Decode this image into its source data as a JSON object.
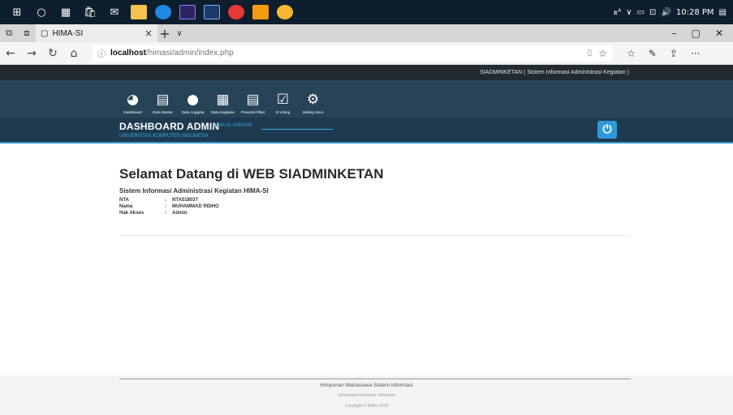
{
  "taskbar": {
    "start_icon": "windows-start-icon",
    "search_icon": "cortana-circle-icon",
    "apps": [
      {
        "name": "task-view-icon",
        "color": "#0f1e2e"
      },
      {
        "name": "store-icon",
        "color": "#0f1e2e"
      },
      {
        "name": "mail-icon",
        "color": "#0f1e2e"
      },
      {
        "name": "file-explorer-icon",
        "color": "#f2c14e"
      },
      {
        "name": "edge-icon",
        "color": "#1e88e5"
      },
      {
        "name": "premiere-icon",
        "color": "#2b2563"
      },
      {
        "name": "photoshop-icon",
        "color": "#1b3a6b"
      },
      {
        "name": "opera-icon",
        "color": "#e53935"
      },
      {
        "name": "app-orange-icon",
        "color": "#f39c12"
      },
      {
        "name": "app-yellow-icon",
        "color": "#f7b733"
      }
    ],
    "tray_user": "ꭱᴬ",
    "tray_chevron": "∨",
    "time": "10:28 PM"
  },
  "browser": {
    "tab_title": "HIMA-SI",
    "url_host": "localhost",
    "url_path": "/himasi/admin/index.php"
  },
  "app": {
    "top_title": "SIADMINKETAN ( Sistem Informasi Administrasi Kegiatan )",
    "nav": [
      {
        "label": "Dashboard",
        "icon": "dashboard-gauge-icon",
        "glyph": "◕"
      },
      {
        "label": "Data Master",
        "icon": "document-icon",
        "glyph": "▤"
      },
      {
        "label": "Data Anggota",
        "icon": "user-icon",
        "glyph": "●"
      },
      {
        "label": "Data Kegiatan",
        "icon": "calendar-icon",
        "glyph": "▦"
      },
      {
        "label": "Presensi Piket",
        "icon": "document-list-icon",
        "glyph": "▤"
      },
      {
        "label": "E-Voting",
        "icon": "checkbox-icon",
        "glyph": "☑"
      },
      {
        "label": "Setting Akun",
        "icon": "gears-icon",
        "glyph": "⚙"
      }
    ],
    "dash_title": "DASHBOARD ADMIN",
    "dash_sub": "HIMA-SI UNIKOM",
    "dash_univ": "UNIVERSITAS KOMPUTER INDONESIA",
    "power_glyph": "⏻"
  },
  "content": {
    "welcome": "Selamat Datang di WEB SIADMINKETAN",
    "subtitle": "Sistem Informasi Administrasi Kegiatan HIMA-SI",
    "fields": [
      {
        "key": "NTA",
        "value": "NTA518037"
      },
      {
        "key": "Nama",
        "value": "MUHAMMAD RIDHO"
      },
      {
        "key": "Hak Akses",
        "value": "Admin"
      }
    ]
  },
  "footer": {
    "line1": "Himpunan Mahasiswa Sistem Informasi",
    "line2": "Universitas Komputer Indonesia",
    "line3": "Copyright © Ridho 2018"
  },
  "colors": {
    "taskbar": "#0f1e2e",
    "app_top": "#222a30",
    "nav_bg": "#274357",
    "header_bg": "#1e3a50",
    "accent": "#2f9ad6"
  }
}
